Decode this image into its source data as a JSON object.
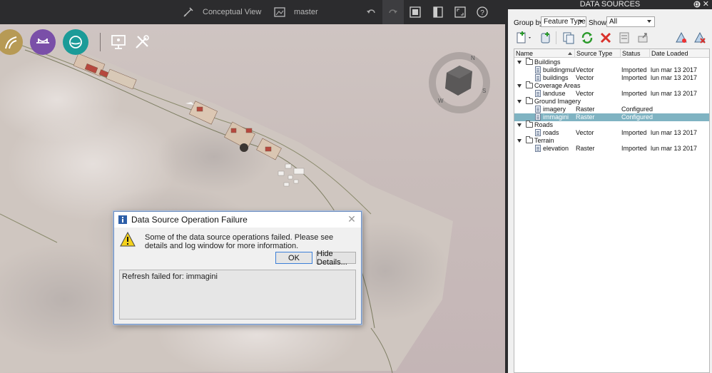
{
  "topbar": {
    "view_label": "Conceptual View",
    "branch_label": "master"
  },
  "dialog": {
    "title": "Data Source Operation Failure",
    "message": "Some of the data source operations failed. Please see details and log window for more information.",
    "ok_label": "OK",
    "details_label": "Hide Details...",
    "details_text": "Refresh failed for: immagini"
  },
  "panel": {
    "title": "DATA SOURCES",
    "group_by_label": "Group by:",
    "group_by_value": "Feature Type",
    "show_label": "Show:",
    "show_value": "All",
    "columns": {
      "name": "Name",
      "source_type": "Source Type",
      "status": "Status",
      "date_loaded": "Date Loaded"
    },
    "groups": [
      {
        "label": "Buildings",
        "items": [
          {
            "name": "buildingmultis",
            "type": "Vector",
            "status": "Imported",
            "date": "lun mar 13 2017"
          },
          {
            "name": "buildings",
            "type": "Vector",
            "status": "Imported",
            "date": "lun mar 13 2017"
          }
        ]
      },
      {
        "label": "Coverage Areas",
        "items": [
          {
            "name": "landuse",
            "type": "Vector",
            "status": "Imported",
            "date": "lun mar 13 2017"
          }
        ]
      },
      {
        "label": "Ground Imagery",
        "items": [
          {
            "name": "imagery",
            "type": "Raster",
            "status": "Configured",
            "date": ""
          },
          {
            "name": "immagini",
            "type": "Raster",
            "status": "Configured",
            "date": "",
            "selected": true
          }
        ]
      },
      {
        "label": "Roads",
        "items": [
          {
            "name": "roads",
            "type": "Vector",
            "status": "Imported",
            "date": "lun mar 13 2017"
          }
        ]
      },
      {
        "label": "Terrain",
        "items": [
          {
            "name": "elevation",
            "type": "Raster",
            "status": "Imported",
            "date": "lun mar 13 2017"
          }
        ]
      }
    ]
  },
  "colors": {
    "topbar": "#2c2c2e",
    "selection": "#7fb3c2",
    "circle_gold": "#b79a55",
    "circle_purple": "#7a4fa8",
    "circle_teal": "#1b9b98"
  }
}
